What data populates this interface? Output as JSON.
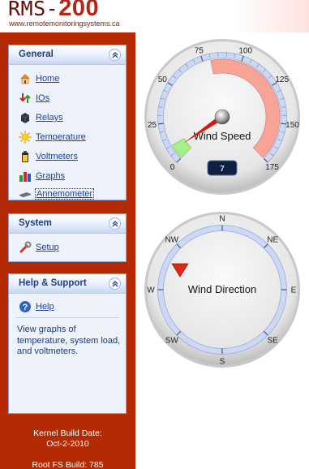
{
  "header": {
    "title_prefix": "RMS-",
    "title_number": "200",
    "url": "www.remotemonitoringsystems.ca"
  },
  "sidebar": {
    "general": {
      "title": "General",
      "items": [
        {
          "label": "Home",
          "icon": "home-icon"
        },
        {
          "label": "IOs",
          "icon": "io-arrows-icon"
        },
        {
          "label": "Relays",
          "icon": "relay-icon"
        },
        {
          "label": "Temperature",
          "icon": "sun-icon"
        },
        {
          "label": "Voltmeters",
          "icon": "battery-icon"
        },
        {
          "label": "Graphs",
          "icon": "bar-chart-icon"
        },
        {
          "label": "Annemometer",
          "icon": "anemometer-icon"
        }
      ]
    },
    "system": {
      "title": "System",
      "items": [
        {
          "label": "Setup",
          "icon": "wrench-icon"
        }
      ]
    },
    "help": {
      "title": "Help & Support",
      "items": [
        {
          "label": "Help",
          "icon": "help-icon"
        }
      ],
      "text": "View graphs of temperature, system load, and voltmeters."
    },
    "build": {
      "kernel_label": "Kernel Build Date:",
      "kernel_date": "Oct-2-2010",
      "rootfs": "Root FS Build: 785"
    }
  },
  "wind_speed": {
    "label": "Wind Speed",
    "value": 7,
    "value_text": "7",
    "min": 0,
    "max": 175,
    "ticks": [
      "0",
      "25",
      "50",
      "75",
      "100",
      "125",
      "150",
      "175"
    ],
    "green_range": [
      0,
      10
    ],
    "red_range": [
      80,
      175
    ],
    "colors": {
      "green": "#a6f08a",
      "red": "#f7a396",
      "needle": "#d41b12",
      "readout_bg": "#0e2040",
      "readout_fg": "#cfe0ff"
    }
  },
  "wind_direction": {
    "label": "Wind Direction",
    "compass": [
      "N",
      "NE",
      "E",
      "SE",
      "S",
      "SW",
      "W",
      "NW"
    ],
    "pointer_color": "#e02518"
  }
}
